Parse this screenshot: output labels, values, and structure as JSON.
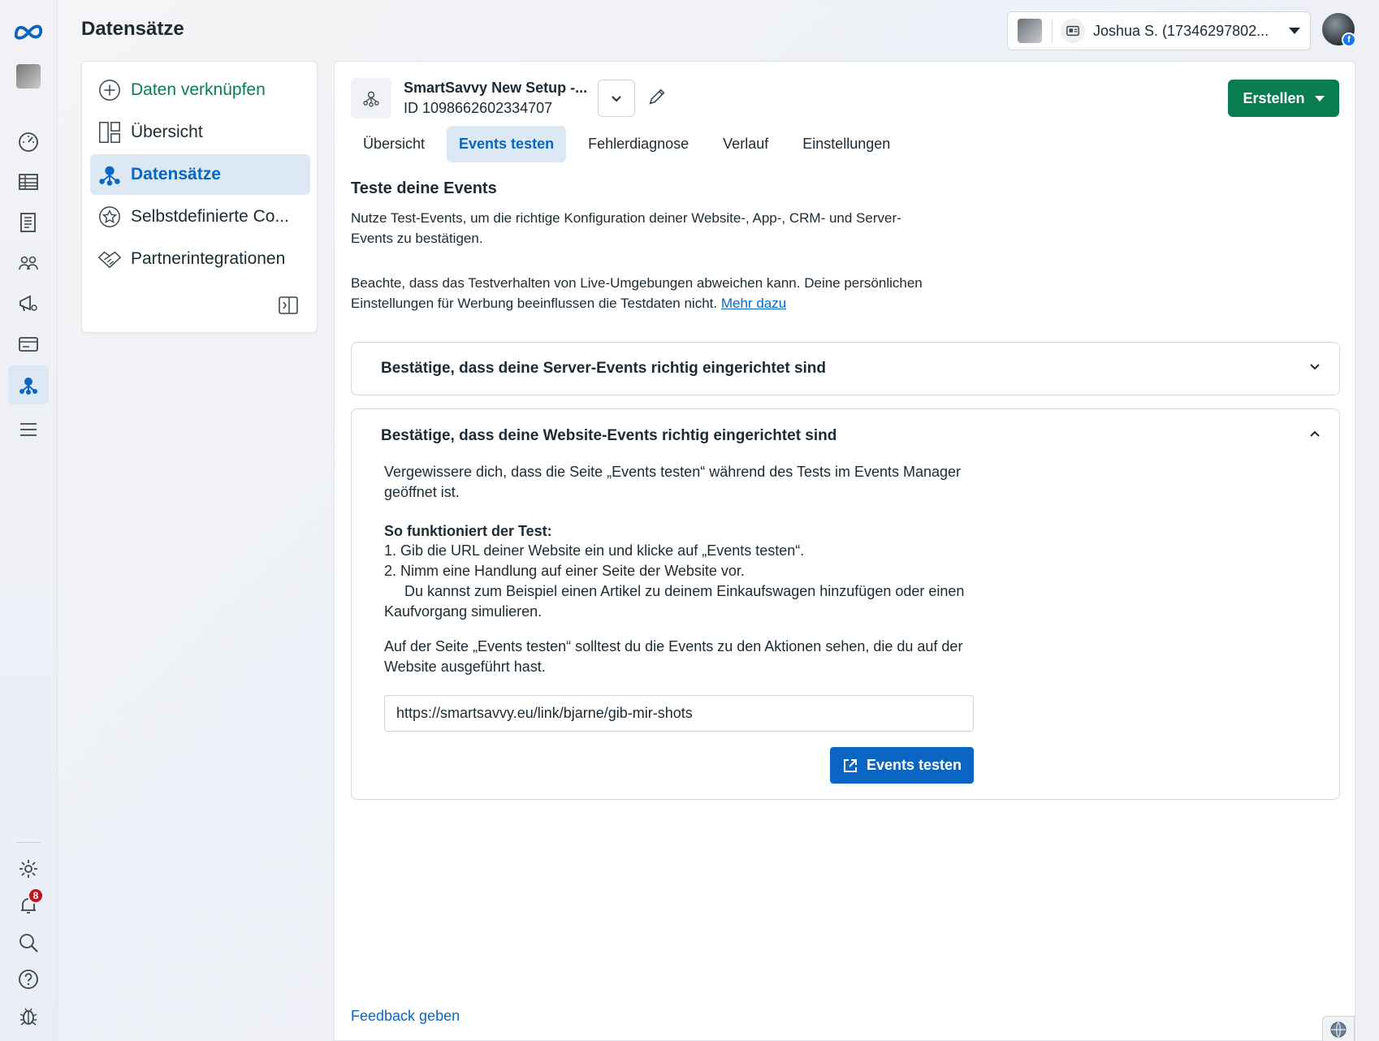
{
  "page_title": "Datensätze",
  "account": {
    "name": "Joshua S. (17346297802..."
  },
  "notifications_count": "8",
  "nav": {
    "items": [
      {
        "label": "Daten verknüpfen"
      },
      {
        "label": "Übersicht"
      },
      {
        "label": "Datensätze"
      },
      {
        "label": "Selbstdefinierte Co..."
      },
      {
        "label": "Partnerintegrationen"
      }
    ]
  },
  "dataset": {
    "name": "SmartSavvy New Setup -...",
    "id": "ID 1098662602334707"
  },
  "create_button": "Erstellen",
  "tabs": [
    "Übersicht",
    "Events testen",
    "Fehlerdiagnose",
    "Verlauf",
    "Einstellungen"
  ],
  "section": {
    "title": "Teste deine Events",
    "intro": "Nutze Test-Events, um die richtige Konfiguration deiner Website-, App-, CRM- und Server-Events zu bestätigen.",
    "note": "Beachte, dass das Testverhalten von Live-Umgebungen abweichen kann. Deine persönlichen Einstellungen für Werbung beeinflussen die Testdaten nicht.",
    "note_link": "Mehr dazu"
  },
  "accordion_server": {
    "title": "Bestätige, dass deine Server-Events richtig eingerichtet sind"
  },
  "accordion_website": {
    "title": "Bestätige, dass deine Website-Events richtig eingerichtet sind",
    "text1": "Vergewissere dich, dass die Seite „Events testen“ während des Tests im Events Manager geöffnet ist.",
    "how_title": "So funktioniert der Test:",
    "step1": "1.  Gib die URL deiner Website ein und klicke auf „Events testen“.",
    "step2": "2.  Nimm eine Handlung auf einer Seite der Website vor.",
    "step2_detail": "Du kannst zum Beispiel einen Artikel zu deinem Einkaufswagen hinzufügen oder einen Kaufvorgang simulieren.",
    "text2": "Auf der Seite „Events testen“ solltest du die Events zu den Aktionen sehen, die du auf der Website ausgeführt hast.",
    "url_value": "https://smartsavvy.eu/link/bjarne/gib-mir-shots",
    "button": "Events testen"
  },
  "feedback": "Feedback geben",
  "colors": {
    "accent_blue": "#0a66c2",
    "accent_green": "#0a7c52",
    "active_bg": "#dce8f3",
    "badge_red": "#c0141e"
  }
}
